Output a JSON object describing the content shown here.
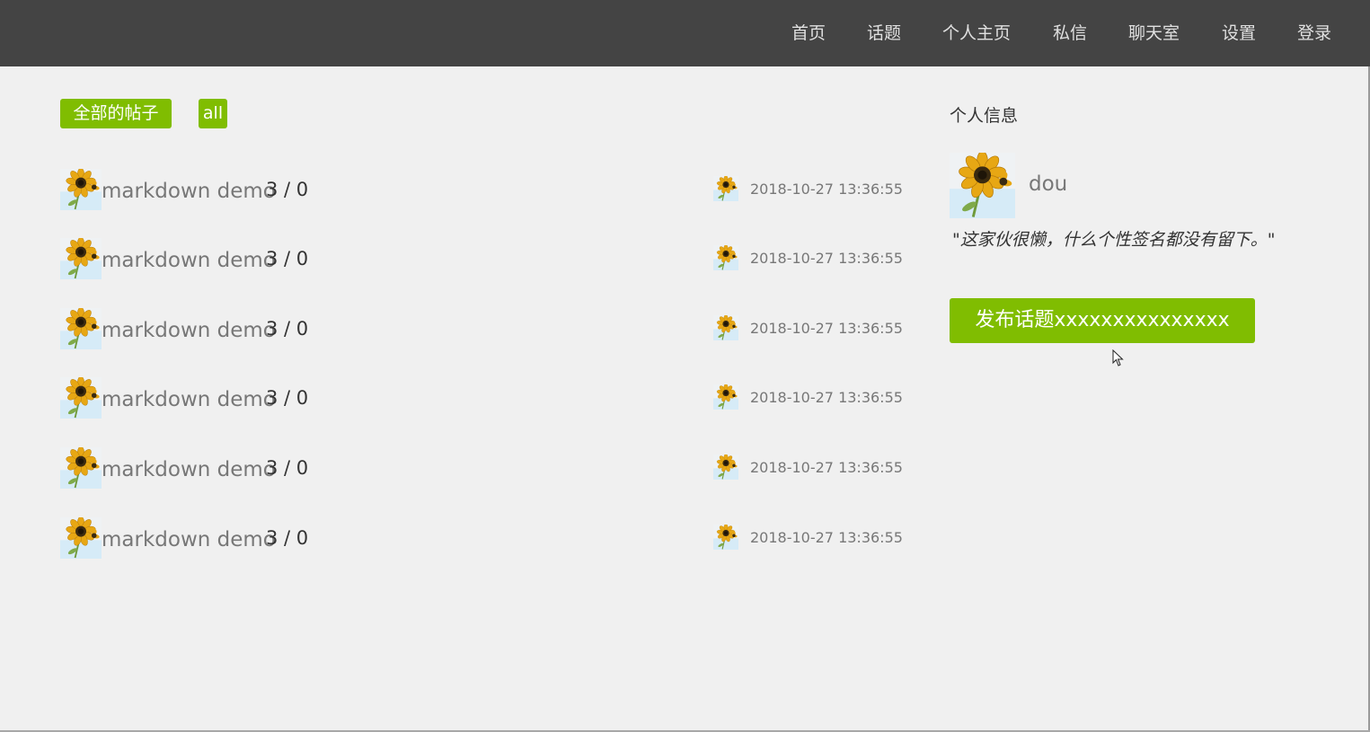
{
  "nav": {
    "items": [
      {
        "label": "首页"
      },
      {
        "label": "话题"
      },
      {
        "label": "个人主页"
      },
      {
        "label": "私信"
      },
      {
        "label": "聊天室"
      },
      {
        "label": "设置"
      },
      {
        "label": "登录"
      }
    ]
  },
  "tabs": {
    "all_posts": "全部的帖子",
    "all": "all"
  },
  "posts": [
    {
      "title": "markdown demo",
      "counts": "3 / 0",
      "time": "2018-10-27 13:36:55"
    },
    {
      "title": "markdown demo",
      "counts": "3 / 0",
      "time": "2018-10-27 13:36:55"
    },
    {
      "title": "markdown demo",
      "counts": "3 / 0",
      "time": "2018-10-27 13:36:55"
    },
    {
      "title": "markdown demo",
      "counts": "3 / 0",
      "time": "2018-10-27 13:36:55"
    },
    {
      "title": "markdown demo",
      "counts": "3 / 0",
      "time": "2018-10-27 13:36:55"
    },
    {
      "title": "markdown demo",
      "counts": "3 / 0",
      "time": "2018-10-27 13:36:55"
    }
  ],
  "profile": {
    "heading": "个人信息",
    "username": "dou",
    "signature": "\"这家伙很懒，什么个性签名都没有留下。\"",
    "publish_button": "发布话题xxxxxxxxxxxxxxx"
  },
  "colors": {
    "navbar_bg": "#444444",
    "accent": "#80bd01",
    "page_bg": "#f0f0f0"
  },
  "icons": {
    "avatar": "sunflower-avatar-icon",
    "cursor": "mouse-pointer-icon"
  }
}
